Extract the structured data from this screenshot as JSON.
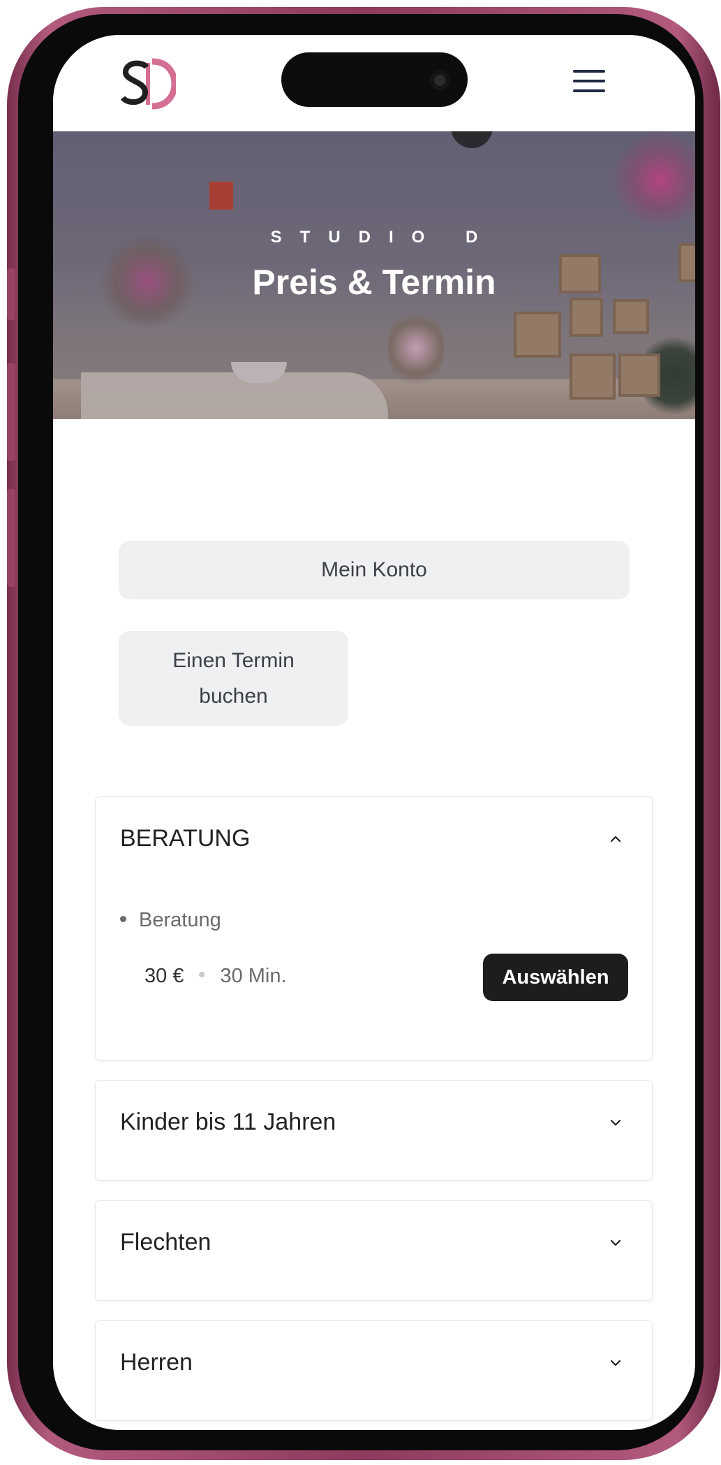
{
  "brand": {
    "logo_text": "SD",
    "accent_color": "#d46e93",
    "dark_color": "#1f1f1f"
  },
  "header": {
    "menu_icon": "hamburger-menu-icon"
  },
  "hero": {
    "kicker": "STUDIO D",
    "title": "Preis & Termin"
  },
  "actions": {
    "account_label": "Mein Konto",
    "book_label": "Einen Termin buchen"
  },
  "categories": [
    {
      "title": "BERATUNG",
      "expanded": true,
      "services": [
        {
          "name": "Beratung",
          "price": "30 €",
          "duration": "30 Min.",
          "select_label": "Auswählen"
        }
      ]
    },
    {
      "title": "Kinder bis 11 Jahren",
      "expanded": false
    },
    {
      "title": "Flechten",
      "expanded": false
    },
    {
      "title": "Herren",
      "expanded": false
    }
  ],
  "colors": {
    "frame": "#a04a70",
    "button_bg": "#eef0f2",
    "select_bg": "#1d1d1f"
  }
}
